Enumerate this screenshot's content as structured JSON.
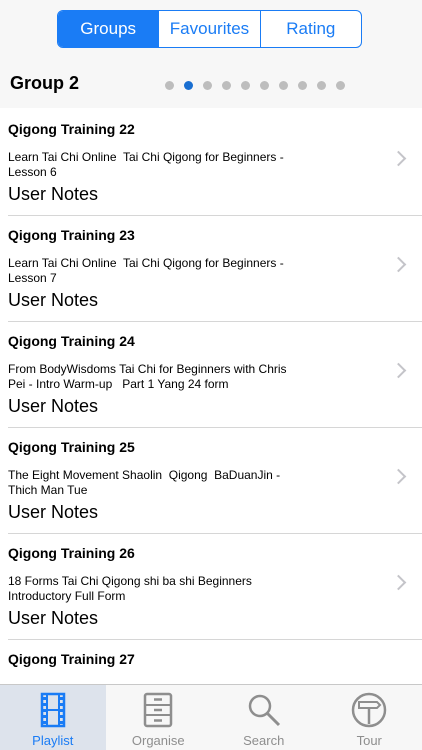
{
  "segments": [
    {
      "label": "Groups",
      "active": true
    },
    {
      "label": "Favourites",
      "active": false
    },
    {
      "label": "Rating",
      "active": false
    }
  ],
  "group": {
    "title": "Group 2",
    "page_count": 10,
    "active_page": 2
  },
  "items": [
    {
      "title": "Qigong Training 22",
      "description": "Learn Tai Chi Online  Tai Chi Qigong for Beginners -\nLesson 6",
      "notes": "User Notes"
    },
    {
      "title": "Qigong Training 23",
      "description": "Learn Tai Chi Online  Tai Chi Qigong for Beginners -\nLesson 7",
      "notes": "User Notes"
    },
    {
      "title": "Qigong Training 24",
      "description": "From BodyWisdoms Tai Chi for Beginners with Chris\nPei - Intro Warm-up   Part 1 Yang 24 form",
      "notes": "User Notes"
    },
    {
      "title": "Qigong Training 25",
      "description": "The Eight Movement Shaolin  Qigong  BaDuanJin -\nThich Man Tue",
      "notes": "User Notes"
    },
    {
      "title": "Qigong Training 26",
      "description": "18 Forms Tai Chi Qigong shi ba shi Beginners\nIntroductory Full Form",
      "notes": "User Notes"
    },
    {
      "title": "Qigong Training 27",
      "description": "",
      "notes": ""
    }
  ],
  "tabs": [
    {
      "label": "Playlist",
      "icon": "film-icon",
      "active": true
    },
    {
      "label": "Organise",
      "icon": "cabinet-icon",
      "active": false
    },
    {
      "label": "Search",
      "icon": "search-icon",
      "active": false
    },
    {
      "label": "Tour",
      "icon": "signpost-icon",
      "active": false
    }
  ],
  "colors": {
    "accent": "#1a7cf5",
    "dot_active": "#1a6fd1",
    "inactive": "#8e8e8e"
  }
}
